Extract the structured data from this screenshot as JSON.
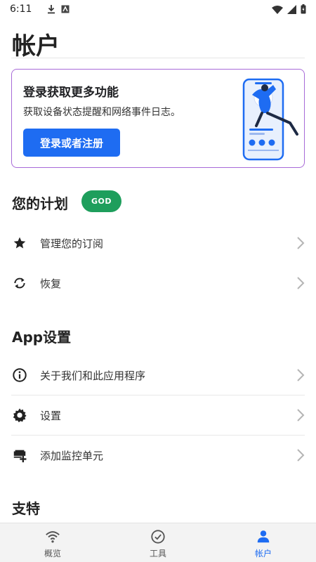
{
  "status_bar": {
    "time": "6:11",
    "left_icons": [
      "download-icon",
      "app-notification-icon"
    ],
    "right_icons": [
      "wifi-icon",
      "signal-icon",
      "battery-icon"
    ]
  },
  "page": {
    "title": "帐户"
  },
  "promo": {
    "title": "登录获取更多功能",
    "subtitle": "获取设备状态提醒和网络事件日志。",
    "button_label": "登录或者注册",
    "button_color": "#1e6cf2",
    "border_color": "#a86ad8"
  },
  "plan_section": {
    "header": "您的计划",
    "badge": "GOD",
    "badge_color": "#1e9e5c",
    "items": [
      {
        "label": "管理您的订阅",
        "icon": "star-icon"
      },
      {
        "label": "恢复",
        "icon": "sync-icon"
      }
    ]
  },
  "app_section": {
    "header": "App设置",
    "items": [
      {
        "label": "关于我们和此应用程序",
        "icon": "info-icon"
      },
      {
        "label": "设置",
        "icon": "gear-icon"
      },
      {
        "label": "添加监控单元",
        "icon": "add-device-icon"
      }
    ]
  },
  "support_section": {
    "header": "支特"
  },
  "bottom_nav": {
    "items": [
      {
        "label": "概览",
        "icon": "wifi-icon",
        "active": false
      },
      {
        "label": "工具",
        "icon": "check-circle-icon",
        "active": false
      },
      {
        "label": "帐户",
        "icon": "person-icon",
        "active": true
      }
    ],
    "active_color": "#1e6cf2"
  }
}
